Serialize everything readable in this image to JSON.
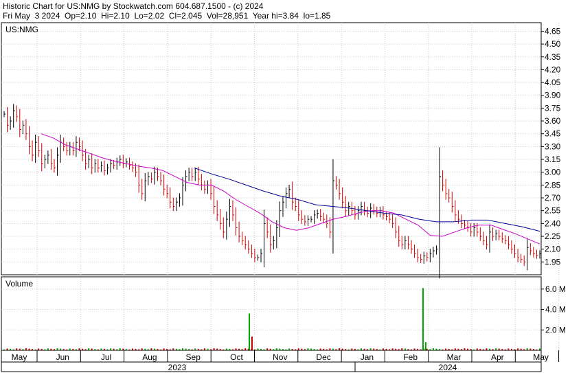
{
  "header": {
    "line1": "Historic Chart for US:NMG by Stockwatch.com 604.687.1500 - (c) 2024",
    "line2": "Fri May  3 2024  Op=2.10  Hi=2.10  Lo=2.02  Cl=2.045  Vol=28,951  Year hi=3.84  lo=1.85"
  },
  "chart_data": [
    {
      "type": "ohlc",
      "panel": "price",
      "title": "US:NMG",
      "ylim": [
        1.8,
        4.75
      ],
      "yticks": [
        1.95,
        2.1,
        2.25,
        2.4,
        2.55,
        2.7,
        2.85,
        3.0,
        3.15,
        3.3,
        3.45,
        3.6,
        3.75,
        3.9,
        4.05,
        4.2,
        4.35,
        4.5,
        4.65
      ],
      "ytick_labels": [
        "1.95",
        "2.10",
        "2.25",
        "2.40",
        "2.55",
        "2.70",
        "2.85",
        "3.00",
        "3.15",
        "3.30",
        "3.45",
        "3.60",
        "3.75",
        "3.90",
        "4.05",
        "4.20",
        "4.35",
        "4.50",
        "4.65"
      ],
      "grid": true,
      "bar_colors": {
        "up": "#000000",
        "down": "#cc0000"
      },
      "series": [
        {
          "label": "close",
          "values": [
            3.68,
            3.55,
            3.6,
            3.72,
            3.65,
            3.5,
            3.55,
            3.45,
            3.3,
            3.2,
            3.35,
            3.25,
            3.1,
            3.15,
            3.2,
            3.1,
            3.05,
            3.2,
            3.35,
            3.3,
            3.25,
            3.3,
            3.25,
            3.35,
            3.3,
            3.2,
            3.1,
            3.15,
            3.05,
            3.1,
            3.05,
            3.08,
            3.02,
            3.05,
            3.1,
            3.08,
            3.12,
            3.15,
            3.1,
            3.12,
            3.08,
            3.05,
            3.0,
            2.85,
            2.75,
            2.9,
            2.95,
            2.92,
            3.0,
            2.95,
            2.9,
            2.8,
            2.75,
            2.65,
            2.6,
            2.65,
            2.7,
            2.85,
            2.95,
            3.0,
            2.95,
            3.0,
            2.92,
            2.85,
            2.8,
            2.85,
            2.75,
            2.6,
            2.5,
            2.4,
            2.3,
            2.45,
            2.6,
            2.5,
            2.35,
            2.25,
            2.2,
            2.15,
            2.1,
            2.05,
            2.0,
            2.0,
            2.05,
            2.4,
            2.3,
            2.15,
            2.2,
            2.35,
            2.55,
            2.65,
            2.75,
            2.8,
            2.65,
            2.6,
            2.5,
            2.45,
            2.42,
            2.45,
            2.45,
            2.5,
            2.52,
            2.48,
            2.45,
            2.4,
            2.3,
            2.9,
            2.85,
            2.75,
            2.65,
            2.55,
            2.6,
            2.55,
            2.5,
            2.55,
            2.6,
            2.55,
            2.52,
            2.58,
            2.55,
            2.52,
            2.55,
            2.5,
            2.48,
            2.45,
            2.4,
            2.3,
            2.2,
            2.15,
            2.2,
            2.15,
            2.1,
            2.05,
            2.0,
            1.98,
            2.02,
            2.0,
            2.05,
            2.08,
            2.1,
            2.95,
            2.85,
            2.75,
            2.7,
            2.6,
            2.5,
            2.45,
            2.4,
            2.38,
            2.35,
            2.3,
            2.35,
            2.3,
            2.25,
            2.2,
            2.15,
            2.3,
            2.25,
            2.28,
            2.25,
            2.22,
            2.2,
            2.15,
            2.1,
            2.05,
            2.0,
            1.98,
            1.95,
            2.12,
            2.08,
            2.05,
            2.03,
            2.045
          ]
        },
        {
          "label": "moving average (short)",
          "color": "#cc00cc",
          "values": [
            3.45,
            3.4,
            3.32,
            3.27,
            3.22,
            3.17,
            3.13,
            3.1,
            3.07,
            3.05,
            3.02,
            2.95,
            2.88,
            2.85,
            2.85,
            2.78,
            2.68,
            2.6,
            2.52,
            2.42,
            2.35,
            2.32,
            2.35,
            2.4,
            2.45,
            2.48,
            2.52,
            2.55,
            2.55,
            2.52,
            2.45,
            2.38,
            2.26,
            2.25,
            2.3,
            2.35,
            2.38,
            2.38,
            2.33,
            2.28,
            2.22,
            2.16
          ]
        },
        {
          "label": "moving average (long)",
          "color": "#000099",
          "values": [
            3.05,
            2.98,
            2.92,
            2.85,
            2.78,
            2.72,
            2.68,
            2.62,
            2.6,
            2.58,
            2.55,
            2.52,
            2.5,
            2.45,
            2.42,
            2.42,
            2.44,
            2.44,
            2.4,
            2.36,
            2.31
          ]
        }
      ]
    },
    {
      "type": "bar",
      "panel": "volume",
      "title": "Volume",
      "ylim": [
        0,
        7.2
      ],
      "yticks": [
        2.0,
        4.0,
        6.0
      ],
      "ytick_labels": [
        "2.0 M",
        "4.0 M",
        "6.0 M"
      ],
      "unit": "millions of shares",
      "notable_values": [
        {
          "date": "early Oct 2023",
          "value": 3.6,
          "color": "#00aa00"
        },
        {
          "date": "early Oct 2023 (next)",
          "value": 1.35,
          "color": "#cc0000"
        },
        {
          "date": "early Feb 2024",
          "value": 6.1,
          "color": "#00aa00"
        },
        {
          "date": "early Feb 2024 (next)",
          "value": 0.8,
          "color": "#00aa00"
        }
      ],
      "baseline_volume": 0.15
    }
  ],
  "x_axis": {
    "months": [
      "May",
      "Jun",
      "Jul",
      "Aug",
      "Sep",
      "Oct",
      "Nov",
      "Dec",
      "Jan",
      "Feb",
      "Mar",
      "Apr",
      "May"
    ],
    "years": [
      "2023",
      "2024"
    ]
  }
}
